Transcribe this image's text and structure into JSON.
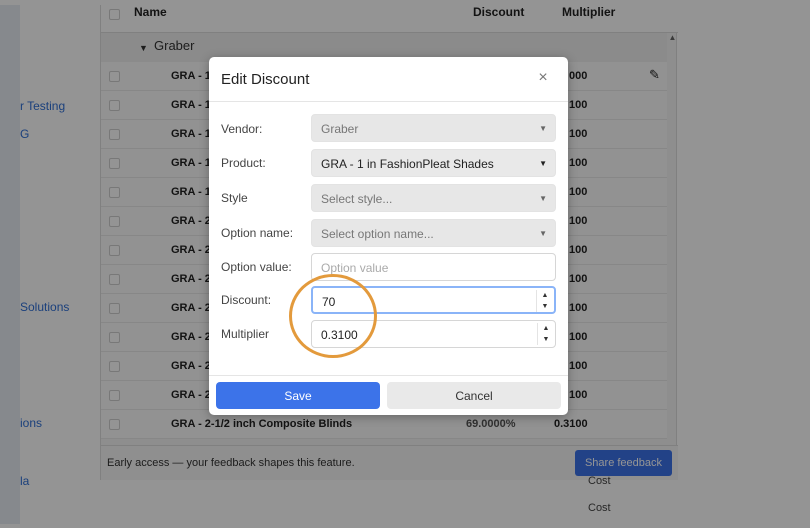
{
  "left_nav": {
    "items": [
      "r Testing",
      "G",
      "Solutions",
      "ions",
      "la"
    ]
  },
  "table": {
    "headers": {
      "name": "Name",
      "discount": "Discount",
      "multiplier": "Multiplier"
    },
    "group_label": "Graber",
    "rows": [
      {
        "name": "GRA - 1",
        "discount": "",
        "multiplier": "000"
      },
      {
        "name": "GRA - 1",
        "discount": "",
        "multiplier": "100"
      },
      {
        "name": "GRA - 1",
        "discount": "",
        "multiplier": "100"
      },
      {
        "name": "GRA - 1",
        "discount": "",
        "multiplier": "100"
      },
      {
        "name": "GRA - 1",
        "discount": "",
        "multiplier": "100"
      },
      {
        "name": "GRA - 2",
        "discount": "",
        "multiplier": "100"
      },
      {
        "name": "GRA - 2",
        "discount": "",
        "multiplier": "100"
      },
      {
        "name": "GRA - 2",
        "discount": "",
        "multiplier": "100"
      },
      {
        "name": "GRA - 2",
        "discount": "",
        "multiplier": "100"
      },
      {
        "name": "GRA - 2",
        "discount": "",
        "multiplier": "100"
      },
      {
        "name": "GRA - 2",
        "discount": "",
        "multiplier": "100"
      },
      {
        "name": "GRA - 2",
        "discount": "",
        "multiplier": "100"
      },
      {
        "name": "GRA - 2-1/2 inch Composite Blinds",
        "discount": "69.0000%",
        "multiplier": "0.3100"
      }
    ],
    "footer_text": "Early access — your feedback shapes this feature.",
    "share_feedback_label": "Share feedback",
    "cost_labels": [
      "Cost",
      "Cost"
    ]
  },
  "modal": {
    "title": "Edit Discount",
    "close_glyph": "×",
    "fields": {
      "vendor": {
        "label": "Vendor:",
        "value": "Graber"
      },
      "product": {
        "label": "Product:",
        "value": "GRA - 1 in FashionPleat Shades"
      },
      "style": {
        "label": "Style",
        "placeholder": "Select style..."
      },
      "option_name": {
        "label": "Option name:",
        "placeholder": "Select option name..."
      },
      "option_value": {
        "label": "Option value:",
        "placeholder": "Option value"
      },
      "discount": {
        "label": "Discount:",
        "value": "70"
      },
      "multiplier": {
        "label": "Multiplier",
        "value": "0.3100"
      }
    },
    "save_label": "Save",
    "cancel_label": "Cancel"
  },
  "colors": {
    "primary_button": "#3c73e9",
    "highlight_ring": "#e39a3c",
    "link": "#2f6fd6"
  }
}
